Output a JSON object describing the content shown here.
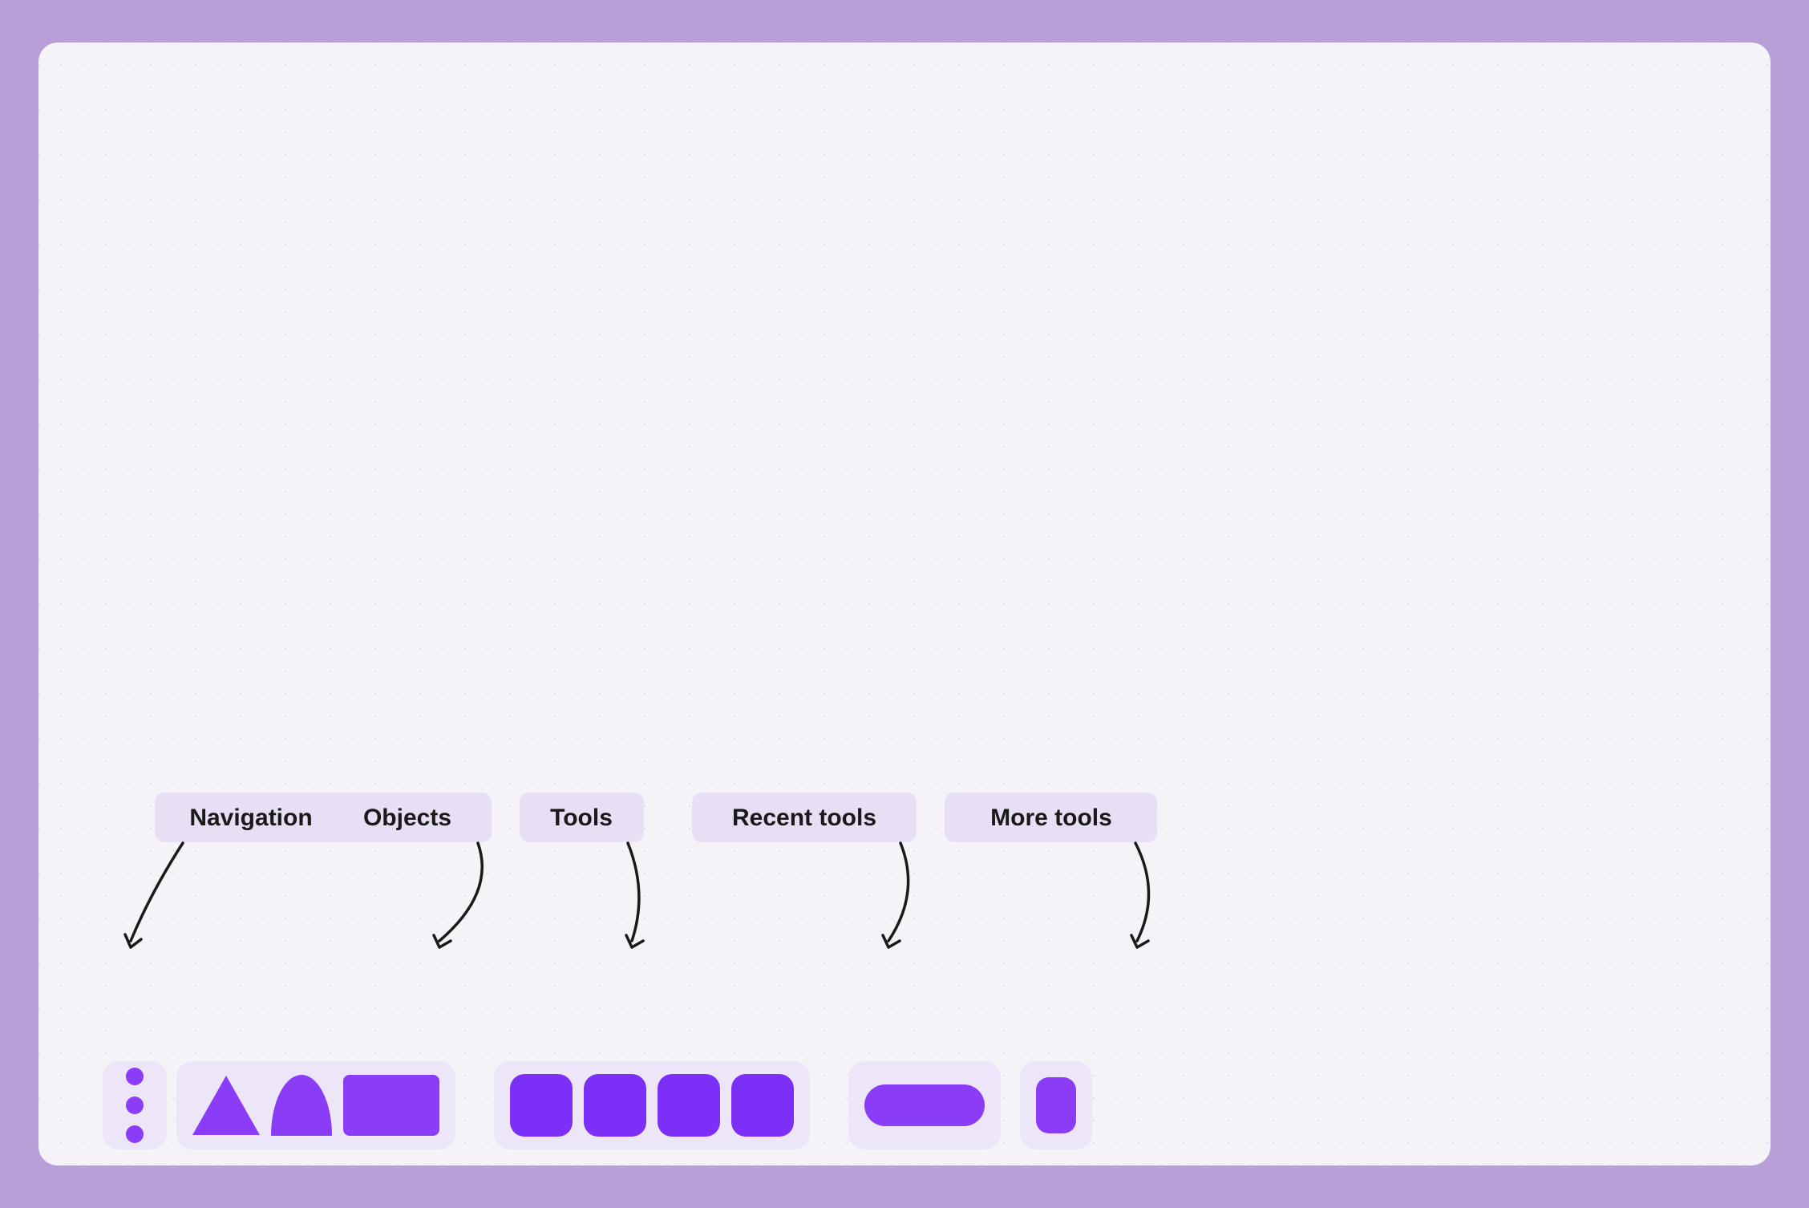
{
  "background_color": "#b89fd8",
  "canvas": {
    "bg_color": "#f5f3f8"
  },
  "labels": {
    "navigation": "Navigation",
    "objects": "Objects",
    "tools": "Tools",
    "recent_tools": "Recent tools",
    "more_tools": "More tools"
  },
  "toolbar": {
    "nav_dots": [
      1,
      2,
      3
    ],
    "objects": [
      "triangle",
      "arch",
      "rectangle"
    ],
    "tools": [
      "tool1",
      "tool2",
      "tool3",
      "tool4"
    ],
    "recent_tools": [
      "recent_pill"
    ],
    "more_tools": [
      "more_item"
    ]
  }
}
